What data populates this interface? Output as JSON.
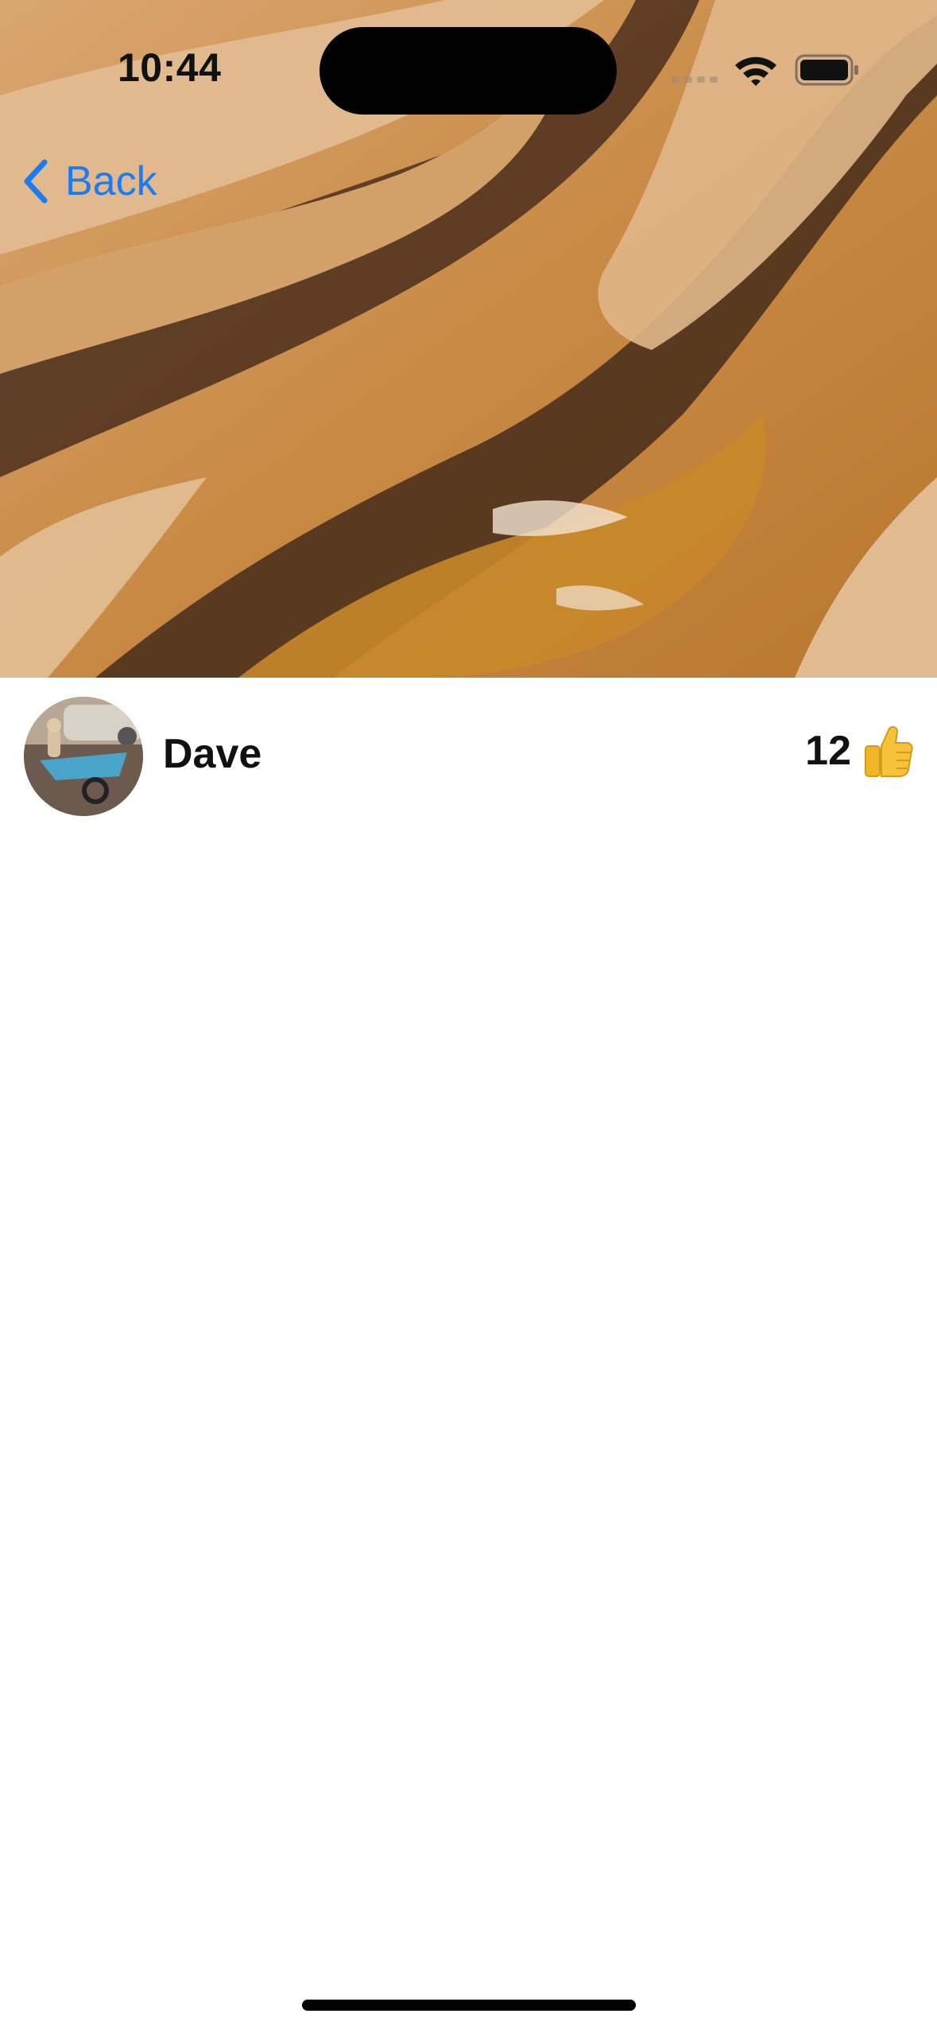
{
  "status_bar": {
    "time": "10:44",
    "icons": [
      "cellular-signal-icon",
      "wifi-icon",
      "battery-icon"
    ]
  },
  "nav": {
    "back_label": "Back",
    "back_icon": "chevron-left-icon"
  },
  "post": {
    "author": "Dave",
    "likes": "12",
    "like_icon": "thumbs-up-icon"
  },
  "colors": {
    "accent": "#1a7cf0",
    "text": "#111111",
    "background": "#ffffff"
  }
}
